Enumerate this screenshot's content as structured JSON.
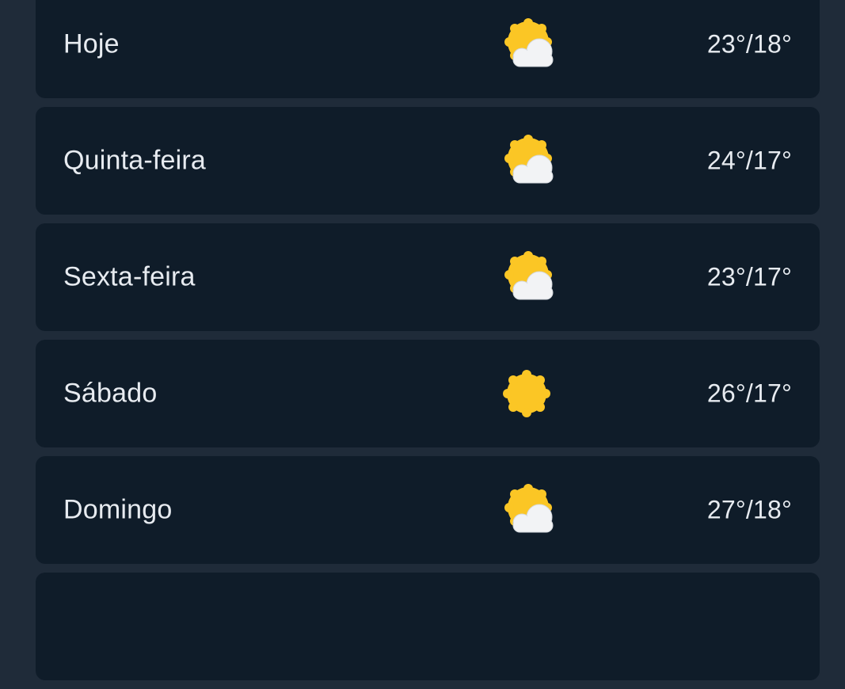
{
  "forecast": {
    "days": [
      {
        "day": "Hoje",
        "temp": "23°/18°",
        "icon": "partly-cloudy-icon"
      },
      {
        "day": "Quinta-feira",
        "temp": "24°/17°",
        "icon": "partly-cloudy-icon"
      },
      {
        "day": "Sexta-feira",
        "temp": "23°/17°",
        "icon": "partly-cloudy-icon"
      },
      {
        "day": "Sábado",
        "temp": "26°/17°",
        "icon": "sunny-icon"
      },
      {
        "day": "Domingo",
        "temp": "27°/18°",
        "icon": "partly-cloudy-icon"
      },
      {
        "day": "",
        "temp": "",
        "icon": ""
      }
    ]
  },
  "colors": {
    "background": "#1f2b39",
    "card": "#0f1c29",
    "text": "#e7ebf0",
    "sun": "#fbc625",
    "cloud": "#f2f3f5"
  }
}
